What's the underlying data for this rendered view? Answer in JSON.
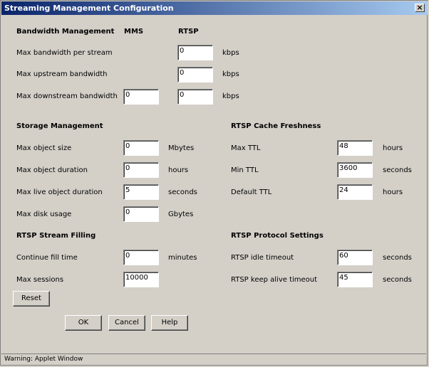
{
  "window": {
    "title": "Streaming Management Configuration",
    "close_glyph": "×"
  },
  "bandwidth": {
    "header": "Bandwidth Management",
    "col_mms": "MMS",
    "col_rtsp": "RTSP",
    "rows": [
      {
        "label": "Max bandwidth per stream",
        "rtsp": "0",
        "unit": "kbps"
      },
      {
        "label": "Max upstream bandwidth",
        "rtsp": "0",
        "unit": "kbps"
      },
      {
        "label": "Max downstream bandwidth",
        "mms": "0",
        "rtsp": "0",
        "unit": "kbps"
      }
    ]
  },
  "storage": {
    "header": "Storage Management",
    "rows": [
      {
        "label": "Max object size",
        "value": "0",
        "unit": "Mbytes"
      },
      {
        "label": "Max object duration",
        "value": "0",
        "unit": "hours"
      },
      {
        "label": "Max live object duration",
        "value": "5",
        "unit": "seconds"
      },
      {
        "label": "Max disk usage",
        "value": "0",
        "unit": "Gbytes"
      }
    ]
  },
  "cache": {
    "header": "RTSP Cache Freshness",
    "rows": [
      {
        "label": "Max TTL",
        "value": "48",
        "unit": "hours"
      },
      {
        "label": "Min TTL",
        "value": "3600",
        "unit": "seconds"
      },
      {
        "label": "Default TTL",
        "value": "24",
        "unit": "hours"
      }
    ]
  },
  "filling": {
    "header": "RTSP Stream Filling",
    "rows": [
      {
        "label": "Continue fill time",
        "value": "0",
        "unit": "minutes"
      },
      {
        "label": "Max sessions",
        "value": "10000",
        "unit": ""
      }
    ]
  },
  "protocol": {
    "header": "RTSP Protocol Settings",
    "rows": [
      {
        "label": "RTSP idle timeout",
        "value": "60",
        "unit": "seconds"
      },
      {
        "label": "RTSP keep alive timeout",
        "value": "45",
        "unit": "seconds"
      }
    ]
  },
  "buttons": {
    "reset": "Reset",
    "ok": "OK",
    "cancel": "Cancel",
    "help": "Help"
  },
  "status": {
    "text": "Warning: Applet Window"
  }
}
